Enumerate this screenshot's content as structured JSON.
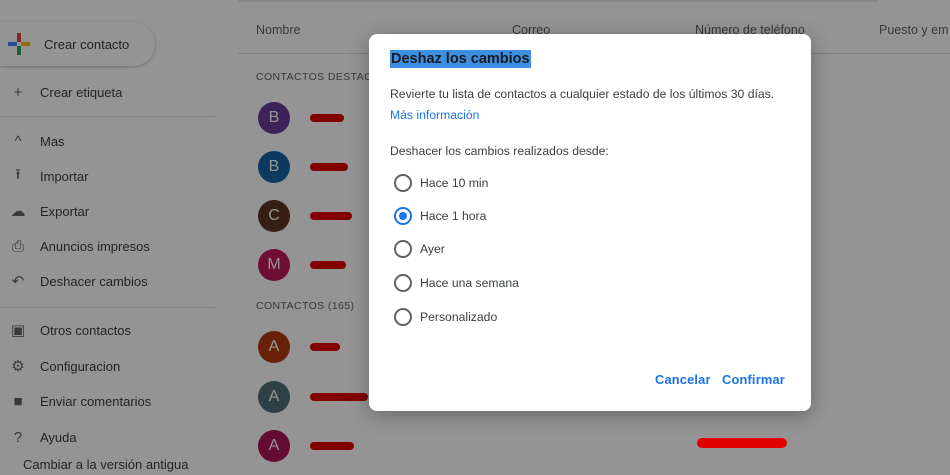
{
  "sidebar": {
    "create_label": "Crear contacto",
    "items": [
      {
        "icon": "plus-icon",
        "glyph": "+",
        "label": "Crear etiqueta"
      },
      {
        "icon": "chevron-up-icon",
        "glyph": "^",
        "label": "Mas"
      },
      {
        "icon": "upload-icon",
        "glyph": "⭱",
        "label": "Importar"
      },
      {
        "icon": "cloud-icon",
        "glyph": "☁",
        "label": "Exportar"
      },
      {
        "icon": "printer-icon",
        "glyph": "⎙",
        "label": "Anuncios impresos"
      },
      {
        "icon": "undo-icon",
        "glyph": "↶",
        "label": "Deshacer cambios"
      },
      {
        "icon": "contacts-icon",
        "glyph": "▣",
        "label": "Otros contactos"
      },
      {
        "icon": "gear-icon",
        "glyph": "⚙",
        "label": "Configuracion"
      },
      {
        "icon": "feedback-icon",
        "glyph": "■",
        "label": "Enviar comentarios"
      },
      {
        "icon": "help-icon",
        "glyph": "?",
        "label": "Ayuda"
      },
      {
        "icon": "",
        "glyph": "",
        "label": "Cambiar a la versión antigua"
      }
    ]
  },
  "table": {
    "columns": [
      "Nombre",
      "Correo",
      "Número de teléfono",
      "Puesto y em"
    ],
    "section_starred": "CONTACTOS DESTACA",
    "section_all": "CONTACTOS (165)",
    "rows": [
      {
        "initial": "B",
        "color": "#6a3d9a"
      },
      {
        "initial": "B",
        "color": "#1565a6"
      },
      {
        "initial": "C",
        "color": "#5d3425"
      },
      {
        "initial": "M",
        "color": "#c2185b"
      },
      {
        "initial": "A",
        "color": "#b33a10"
      },
      {
        "initial": "A",
        "color": "#546e7a"
      },
      {
        "initial": "A",
        "color": "#ad1457"
      }
    ]
  },
  "dialog": {
    "title": "Deshaz los cambios",
    "description": "Revierte tu lista de contactos a cualquier estado de los últimos 30 días.",
    "link": "Más información",
    "subheading": "Deshacer los cambios realizados desde:",
    "options": [
      {
        "label": "Hace 10 min",
        "selected": false
      },
      {
        "label": "Hace 1 hora",
        "selected": true
      },
      {
        "label": "Ayer",
        "selected": false
      },
      {
        "label": "Hace una semana",
        "selected": false
      },
      {
        "label": "Personalizado",
        "selected": false
      }
    ],
    "cancel_label": "Cancelar",
    "confirm_label": "Confirmar"
  },
  "colors": {
    "accent": "#1a73e8",
    "redaction": "#e00000"
  }
}
